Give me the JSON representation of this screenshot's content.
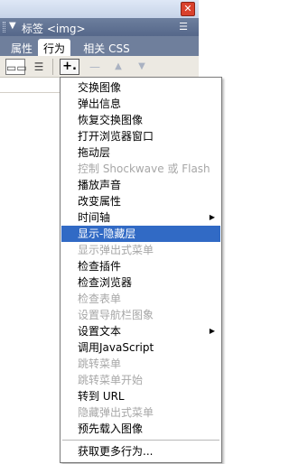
{
  "panel": {
    "title": "标签 <img>",
    "tabs": [
      "属性",
      "行为",
      "相关 CSS"
    ]
  },
  "toolbar": {
    "add_label": "+.",
    "remove_label": "—",
    "up_label": "▲",
    "down_label": "▼"
  },
  "menu": {
    "items": [
      {
        "label": "交换图像",
        "enabled": true
      },
      {
        "label": "弹出信息",
        "enabled": true
      },
      {
        "label": "恢复交换图像",
        "enabled": true
      },
      {
        "label": "打开浏览器窗口",
        "enabled": true
      },
      {
        "label": "拖动层",
        "enabled": true
      },
      {
        "label": "控制 Shockwave 或 Flash",
        "enabled": false
      },
      {
        "label": "播放声音",
        "enabled": true
      },
      {
        "label": "改变属性",
        "enabled": true
      },
      {
        "label": "时间轴",
        "enabled": true,
        "submenu": true
      },
      {
        "label": "显示-隐藏层",
        "enabled": true,
        "selected": true
      },
      {
        "label": "显示弹出式菜单",
        "enabled": false
      },
      {
        "label": "检查插件",
        "enabled": true
      },
      {
        "label": "检查浏览器",
        "enabled": true
      },
      {
        "label": "检查表单",
        "enabled": false
      },
      {
        "label": "设置导航栏图象",
        "enabled": false
      },
      {
        "label": "设置文本",
        "enabled": true,
        "submenu": true
      },
      {
        "label": "调用JavaScript",
        "enabled": true
      },
      {
        "label": "跳转菜单",
        "enabled": false
      },
      {
        "label": "跳转菜单开始",
        "enabled": false
      },
      {
        "label": "转到 URL",
        "enabled": true
      },
      {
        "label": "隐藏弹出式菜单",
        "enabled": false
      },
      {
        "label": "预先载入图像",
        "enabled": true
      }
    ],
    "footer_item": "获取更多行为..."
  }
}
